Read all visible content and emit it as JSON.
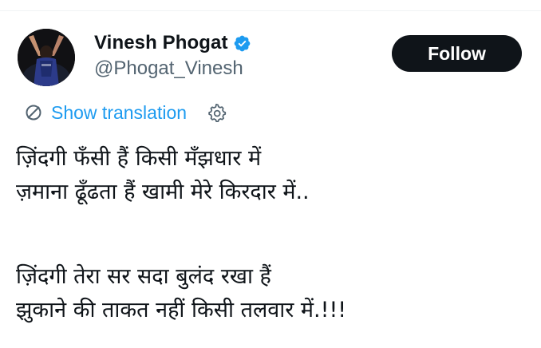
{
  "author": {
    "display_name": "Vinesh Phogat",
    "handle": "@Phogat_Vinesh",
    "avatar_icon": "wrestler-avatar",
    "verified_icon": "verified-badge-icon",
    "verified_color": "#1d9bf0"
  },
  "actions": {
    "follow_label": "Follow"
  },
  "translation": {
    "label": "Show translation",
    "icon": "translate-icon",
    "settings_icon": "gear-icon",
    "link_color": "#1d9bf0"
  },
  "tweet": {
    "stanza1": [
      "ज़िंदगी फँसी हैं किसी मँझधार में",
      "ज़माना ढूँढता हैं खामी मेरे किरदार में.."
    ],
    "stanza2": [
      "ज़िंदगी तेरा सर सदा बुलंद रखा हैं",
      "झुकाने की ताकत नहीं किसी तलवार में.!!!"
    ]
  },
  "colors": {
    "text_primary": "#0f1419",
    "text_secondary": "#536471",
    "button_bg": "#0f1419",
    "button_text": "#ffffff"
  }
}
